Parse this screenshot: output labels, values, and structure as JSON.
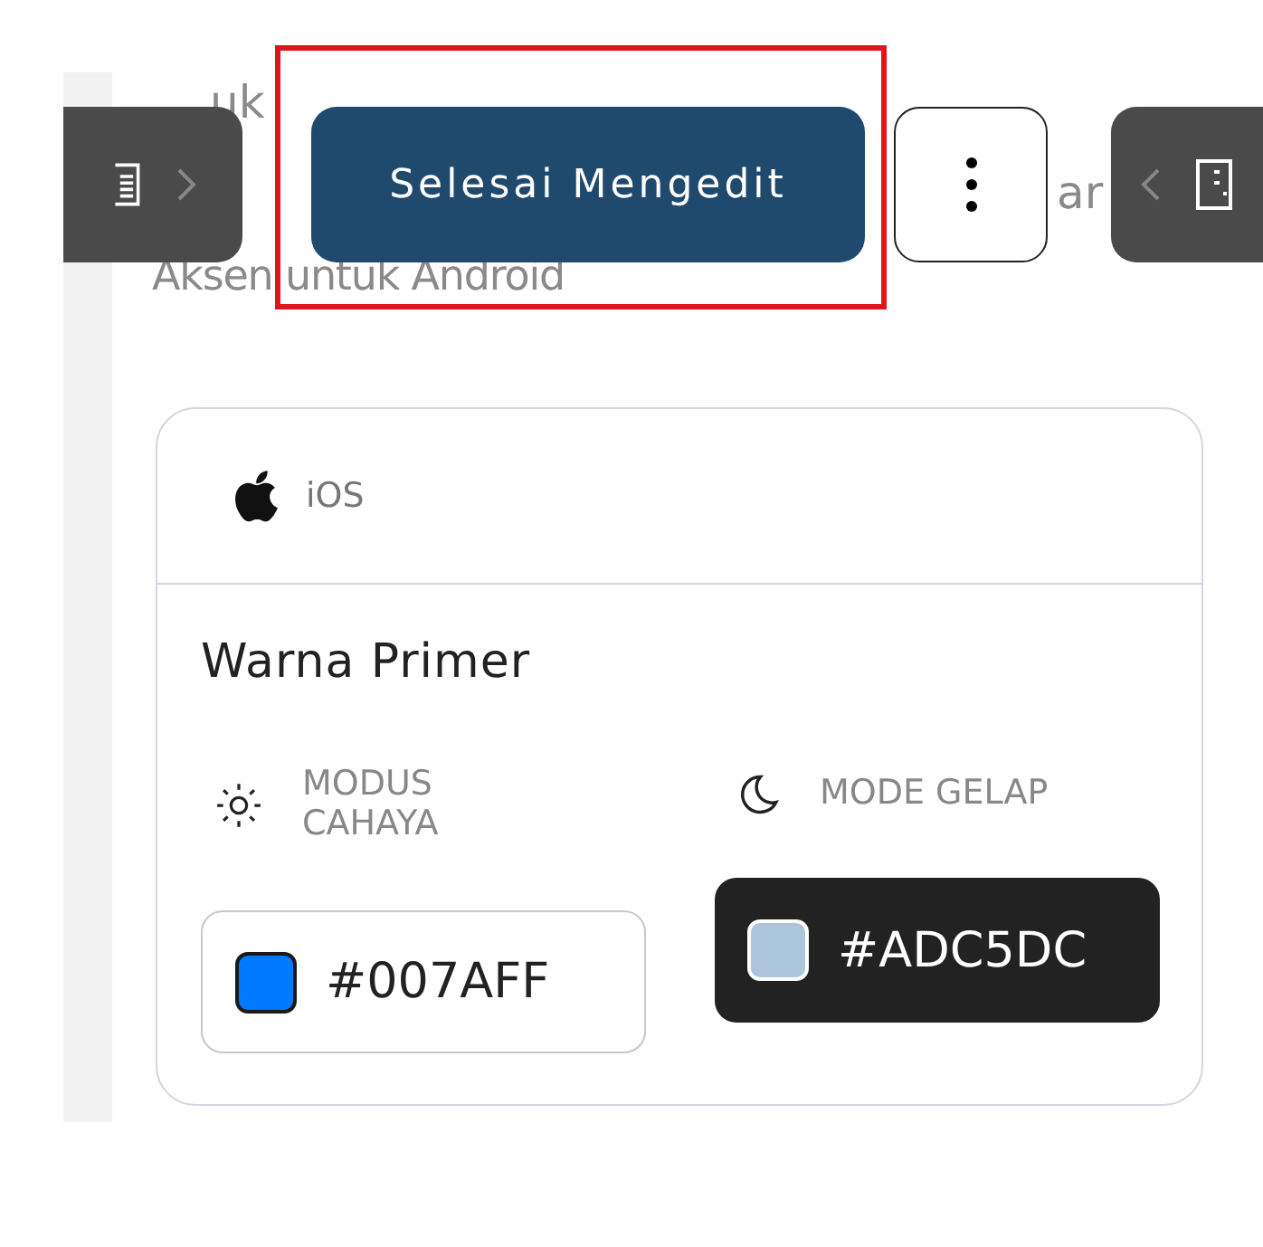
{
  "background_text": {
    "line_1": [
      "uk"
    ],
    "line_2": [
      "ar"
    ],
    "line_3": "Aksen untuk Android"
  },
  "toolbar": {
    "done_button": {
      "label": "Selesai Mengedit",
      "highlighted": true
    }
  },
  "card": {
    "platform": "iOS",
    "section_title": "Warna Primer",
    "modes": [
      {
        "kind": "light",
        "label": "MODUS CAHAYA",
        "value": "#007AFF",
        "color": "#007aff"
      },
      {
        "kind": "dark",
        "label": "MODE GELAP",
        "value": "#ADC5DC",
        "color": "#adc5dc"
      }
    ]
  }
}
